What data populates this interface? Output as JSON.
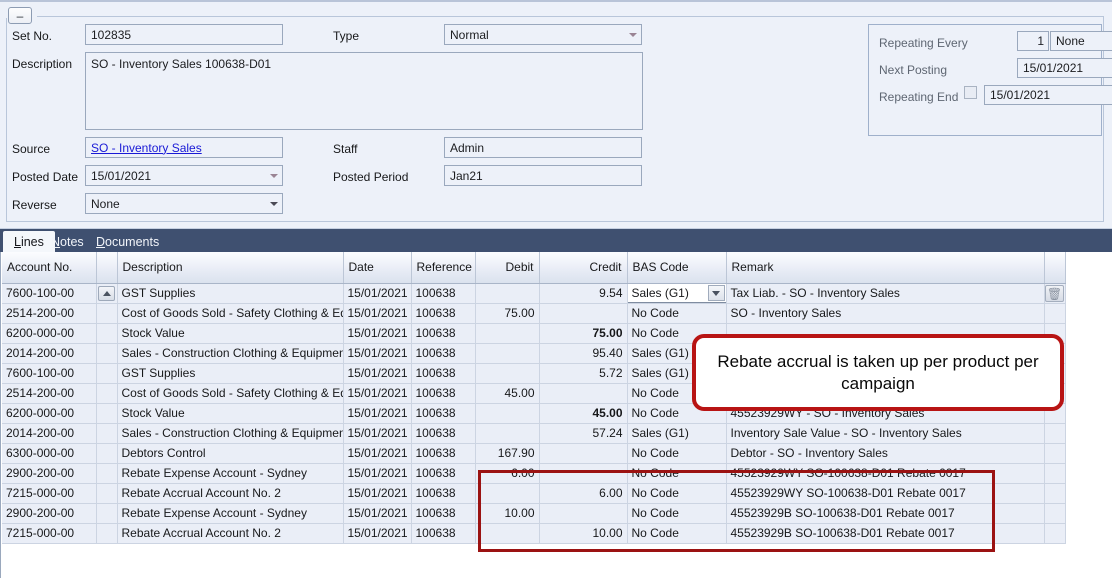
{
  "header": {
    "collapse_icon": "minus-icon",
    "fields": {
      "set_no_label": "Set No.",
      "set_no_value": "102835",
      "description_label": "Description",
      "description_value": "SO - Inventory Sales 100638-D01",
      "source_label": "Source",
      "source_value": "SO - Inventory Sales",
      "posted_date_label": "Posted Date",
      "posted_date_value": "15/01/2021",
      "reverse_label": "Reverse",
      "reverse_value": "None",
      "type_label": "Type",
      "type_value": "Normal",
      "staff_label": "Staff",
      "staff_value": "Admin",
      "posted_period_label": "Posted Period",
      "posted_period_value": "Jan21"
    },
    "repeating": {
      "every_label": "Repeating Every",
      "every_count": "1",
      "every_unit": "None",
      "next_posting_label": "Next Posting",
      "next_posting_value": "15/01/2021",
      "end_label": "Repeating End",
      "end_value": "15/01/2021",
      "end_checked": false
    }
  },
  "tabs": [
    {
      "label": "Lines",
      "accel": "L",
      "rest": "ines",
      "active": true
    },
    {
      "label": "Notes",
      "accel": "N",
      "rest": "otes",
      "active": false
    },
    {
      "label": "Documents",
      "accel": "D",
      "rest": "ocuments",
      "active": false
    }
  ],
  "grid": {
    "columns": [
      "Account No.",
      "",
      "Description",
      "Date",
      "Reference",
      "Debit",
      "Credit",
      "BAS Code",
      "Remark",
      ""
    ],
    "rows": [
      {
        "account": "7600-100-00",
        "sort_icon": "sort-ascending-icon",
        "description": "GST Supplies",
        "date": "15/01/2021",
        "reference": "100638",
        "debit": "",
        "credit": "9.54",
        "credit_bold": false,
        "bas_code": "Sales (G1)",
        "bas_active": true,
        "remark": "Tax Liab. - SO - Inventory Sales",
        "action_icon": "trash-icon"
      },
      {
        "account": "2514-200-00",
        "description": "Cost of Goods Sold - Safety Clothing & Equipment",
        "date": "15/01/2021",
        "reference": "100638",
        "debit": "75.00",
        "credit": "",
        "credit_bold": false,
        "bas_code": "No Code",
        "remark": "SO - Inventory Sales"
      },
      {
        "account": "6200-000-00",
        "description": "Stock Value",
        "date": "15/01/2021",
        "reference": "100638",
        "debit": "",
        "credit": "75.00",
        "credit_bold": true,
        "bas_code": "No Code",
        "remark": ""
      },
      {
        "account": "2014-200-00",
        "description": "Sales - Construction Clothing & Equipment NSW",
        "date": "15/01/2021",
        "reference": "100638",
        "debit": "",
        "credit": "95.40",
        "credit_bold": false,
        "bas_code": "Sales (G1)",
        "remark": ""
      },
      {
        "account": "7600-100-00",
        "description": "GST Supplies",
        "date": "15/01/2021",
        "reference": "100638",
        "debit": "",
        "credit": "5.72",
        "credit_bold": false,
        "bas_code": "Sales (G1)",
        "remark": ""
      },
      {
        "account": "2514-200-00",
        "description": "Cost of Goods Sold - Safety Clothing & Equipment",
        "date": "15/01/2021",
        "reference": "100638",
        "debit": "45.00",
        "credit": "",
        "credit_bold": false,
        "bas_code": "No Code",
        "remark": ""
      },
      {
        "account": "6200-000-00",
        "description": "Stock Value",
        "date": "15/01/2021",
        "reference": "100638",
        "debit": "",
        "credit": "45.00",
        "credit_bold": true,
        "bas_code": "No Code",
        "remark": "45523929WY - SO - Inventory Sales"
      },
      {
        "account": "2014-200-00",
        "description": "Sales - Construction Clothing & Equipment NSW",
        "date": "15/01/2021",
        "reference": "100638",
        "debit": "",
        "credit": "57.24",
        "credit_bold": false,
        "bas_code": "Sales (G1)",
        "remark": "Inventory Sale Value - SO - Inventory Sales"
      },
      {
        "account": "6300-000-00",
        "description": "Debtors Control",
        "date": "15/01/2021",
        "reference": "100638",
        "debit": "167.90",
        "credit": "",
        "credit_bold": false,
        "bas_code": "No Code",
        "remark": "Debtor - SO - Inventory Sales"
      },
      {
        "account": "2900-200-00",
        "description": "Rebate Expense Account - Sydney",
        "date": "15/01/2021",
        "reference": "100638",
        "debit": "6.00",
        "credit": "",
        "credit_bold": false,
        "bas_code": "No Code",
        "remark": "45523929WY SO-100638-D01 Rebate 0017"
      },
      {
        "account": "7215-000-00",
        "description": "Rebate Accrual Account No. 2",
        "date": "15/01/2021",
        "reference": "100638",
        "debit": "",
        "credit": "6.00",
        "credit_bold": false,
        "bas_code": "No Code",
        "remark": "45523929WY SO-100638-D01 Rebate 0017"
      },
      {
        "account": "2900-200-00",
        "description": "Rebate Expense Account - Sydney",
        "date": "15/01/2021",
        "reference": "100638",
        "debit": "10.00",
        "credit": "",
        "credit_bold": false,
        "bas_code": "No Code",
        "remark": "45523929B SO-100638-D01 Rebate 0017"
      },
      {
        "account": "7215-000-00",
        "description": "Rebate Accrual Account No. 2",
        "date": "15/01/2021",
        "reference": "100638",
        "debit": "",
        "credit": "10.00",
        "credit_bold": false,
        "bas_code": "No Code",
        "remark": "45523929B SO-100638-D01 Rebate 0017"
      }
    ]
  },
  "annotations": {
    "callout_text": "Rebate accrual is taken up per product per campaign",
    "callout_color": "#b81414",
    "highlight_color": "#9b1212"
  },
  "colors": {
    "form_bg": "#edf1f9",
    "tabstrip": "#3f5070",
    "row_bg": "#eaeef7",
    "link": "#1919d6"
  }
}
